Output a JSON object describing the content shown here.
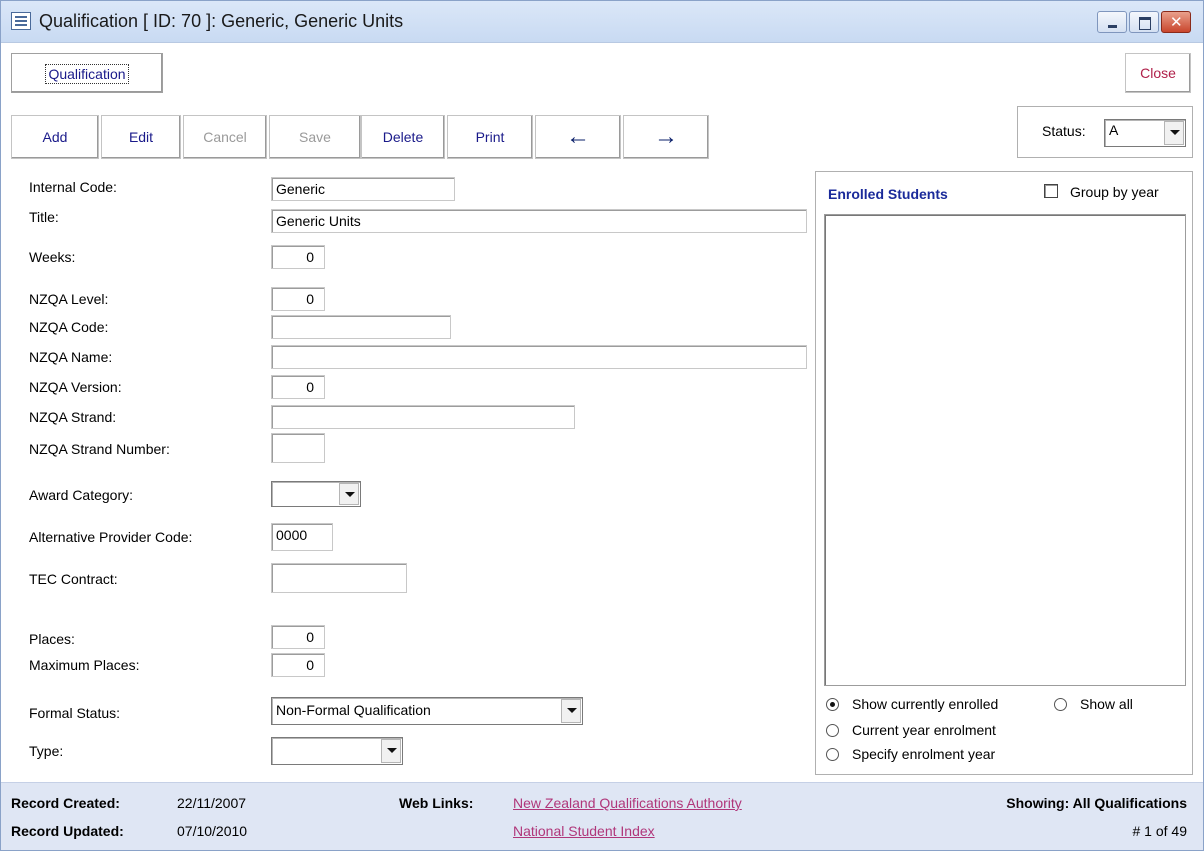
{
  "window": {
    "title": "Qualification [ ID: 70 ]: Generic, Generic Units"
  },
  "header": {
    "qualification_button": "Qualification",
    "close_button": "Close"
  },
  "toolbar": {
    "add": "Add",
    "edit": "Edit",
    "cancel": "Cancel",
    "save": "Save",
    "delete": "Delete",
    "print": "Print",
    "prev_icon": "arrow-left-icon",
    "next_icon": "arrow-right-icon",
    "prev_glyph": "🡐",
    "next_glyph": "🡒"
  },
  "status": {
    "label": "Status:",
    "value": "A"
  },
  "form": {
    "internal_code": {
      "label": "Internal Code:",
      "value": "Generic"
    },
    "title": {
      "label": "Title:",
      "value": "Generic Units"
    },
    "weeks": {
      "label": "Weeks:",
      "value": "0"
    },
    "nzqa_level": {
      "label": "NZQA Level:",
      "value": "0"
    },
    "nzqa_code": {
      "label": "NZQA Code:",
      "value": ""
    },
    "nzqa_name": {
      "label": "NZQA Name:",
      "value": ""
    },
    "nzqa_version": {
      "label": "NZQA Version:",
      "value": "0"
    },
    "nzqa_strand": {
      "label": "NZQA Strand:",
      "value": ""
    },
    "nzqa_strand_number": {
      "label": "NZQA Strand Number:",
      "value": ""
    },
    "award_category": {
      "label": "Award Category:",
      "value": ""
    },
    "alt_provider_code": {
      "label": "Alternative Provider Code:",
      "value": "0000"
    },
    "tec_contract": {
      "label": "TEC Contract:",
      "value": ""
    },
    "places": {
      "label": "Places:",
      "value": "0"
    },
    "maximum_places": {
      "label": "Maximum Places:",
      "value": "0"
    },
    "formal_status": {
      "label": "Formal Status:",
      "value": "Non-Formal Qualification"
    },
    "type": {
      "label": "Type:",
      "value": ""
    }
  },
  "enrolled": {
    "heading": "Enrolled Students",
    "group_by_year": "Group by year",
    "group_by_year_checked": false,
    "options": {
      "show_current": "Show currently enrolled",
      "show_all": "Show all",
      "current_year": "Current year enrolment",
      "specify_year": "Specify enrolment year"
    },
    "selected": "show_current"
  },
  "footer": {
    "created_label": "Record Created:",
    "created_value": "22/11/2007",
    "updated_label": "Record Updated:",
    "updated_value": "07/10/2010",
    "web_links_label": "Web Links:",
    "link_nzqa": "New Zealand Qualifications Authority",
    "link_nsi": "National Student Index",
    "showing": "Showing: All Qualifications",
    "record_pos": "# 1 of 49"
  },
  "colors": {
    "link": "#b0367a",
    "button_text": "#1a1a8a",
    "heading": "#1a2a9a",
    "footer_bg": "#dfe6f4"
  }
}
